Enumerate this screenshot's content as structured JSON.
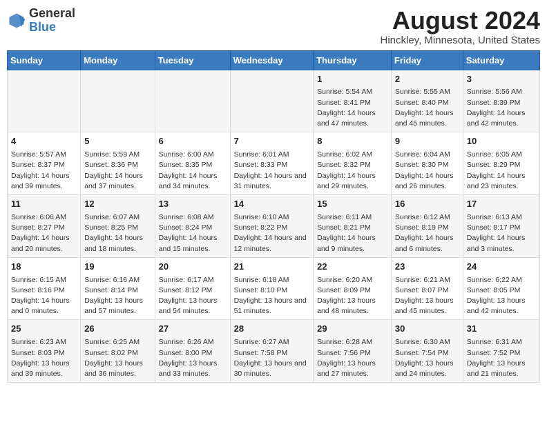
{
  "header": {
    "logo_general": "General",
    "logo_blue": "Blue",
    "month_year": "August 2024",
    "location": "Hinckley, Minnesota, United States"
  },
  "days_of_week": [
    "Sunday",
    "Monday",
    "Tuesday",
    "Wednesday",
    "Thursday",
    "Friday",
    "Saturday"
  ],
  "weeks": [
    [
      {
        "day": "",
        "sunrise": "",
        "sunset": "",
        "daylight": ""
      },
      {
        "day": "",
        "sunrise": "",
        "sunset": "",
        "daylight": ""
      },
      {
        "day": "",
        "sunrise": "",
        "sunset": "",
        "daylight": ""
      },
      {
        "day": "",
        "sunrise": "",
        "sunset": "",
        "daylight": ""
      },
      {
        "day": "1",
        "sunrise": "Sunrise: 5:54 AM",
        "sunset": "Sunset: 8:41 PM",
        "daylight": "Daylight: 14 hours and 47 minutes."
      },
      {
        "day": "2",
        "sunrise": "Sunrise: 5:55 AM",
        "sunset": "Sunset: 8:40 PM",
        "daylight": "Daylight: 14 hours and 45 minutes."
      },
      {
        "day": "3",
        "sunrise": "Sunrise: 5:56 AM",
        "sunset": "Sunset: 8:39 PM",
        "daylight": "Daylight: 14 hours and 42 minutes."
      }
    ],
    [
      {
        "day": "4",
        "sunrise": "Sunrise: 5:57 AM",
        "sunset": "Sunset: 8:37 PM",
        "daylight": "Daylight: 14 hours and 39 minutes."
      },
      {
        "day": "5",
        "sunrise": "Sunrise: 5:59 AM",
        "sunset": "Sunset: 8:36 PM",
        "daylight": "Daylight: 14 hours and 37 minutes."
      },
      {
        "day": "6",
        "sunrise": "Sunrise: 6:00 AM",
        "sunset": "Sunset: 8:35 PM",
        "daylight": "Daylight: 14 hours and 34 minutes."
      },
      {
        "day": "7",
        "sunrise": "Sunrise: 6:01 AM",
        "sunset": "Sunset: 8:33 PM",
        "daylight": "Daylight: 14 hours and 31 minutes."
      },
      {
        "day": "8",
        "sunrise": "Sunrise: 6:02 AM",
        "sunset": "Sunset: 8:32 PM",
        "daylight": "Daylight: 14 hours and 29 minutes."
      },
      {
        "day": "9",
        "sunrise": "Sunrise: 6:04 AM",
        "sunset": "Sunset: 8:30 PM",
        "daylight": "Daylight: 14 hours and 26 minutes."
      },
      {
        "day": "10",
        "sunrise": "Sunrise: 6:05 AM",
        "sunset": "Sunset: 8:29 PM",
        "daylight": "Daylight: 14 hours and 23 minutes."
      }
    ],
    [
      {
        "day": "11",
        "sunrise": "Sunrise: 6:06 AM",
        "sunset": "Sunset: 8:27 PM",
        "daylight": "Daylight: 14 hours and 20 minutes."
      },
      {
        "day": "12",
        "sunrise": "Sunrise: 6:07 AM",
        "sunset": "Sunset: 8:25 PM",
        "daylight": "Daylight: 14 hours and 18 minutes."
      },
      {
        "day": "13",
        "sunrise": "Sunrise: 6:08 AM",
        "sunset": "Sunset: 8:24 PM",
        "daylight": "Daylight: 14 hours and 15 minutes."
      },
      {
        "day": "14",
        "sunrise": "Sunrise: 6:10 AM",
        "sunset": "Sunset: 8:22 PM",
        "daylight": "Daylight: 14 hours and 12 minutes."
      },
      {
        "day": "15",
        "sunrise": "Sunrise: 6:11 AM",
        "sunset": "Sunset: 8:21 PM",
        "daylight": "Daylight: 14 hours and 9 minutes."
      },
      {
        "day": "16",
        "sunrise": "Sunrise: 6:12 AM",
        "sunset": "Sunset: 8:19 PM",
        "daylight": "Daylight: 14 hours and 6 minutes."
      },
      {
        "day": "17",
        "sunrise": "Sunrise: 6:13 AM",
        "sunset": "Sunset: 8:17 PM",
        "daylight": "Daylight: 14 hours and 3 minutes."
      }
    ],
    [
      {
        "day": "18",
        "sunrise": "Sunrise: 6:15 AM",
        "sunset": "Sunset: 8:16 PM",
        "daylight": "Daylight: 14 hours and 0 minutes."
      },
      {
        "day": "19",
        "sunrise": "Sunrise: 6:16 AM",
        "sunset": "Sunset: 8:14 PM",
        "daylight": "Daylight: 13 hours and 57 minutes."
      },
      {
        "day": "20",
        "sunrise": "Sunrise: 6:17 AM",
        "sunset": "Sunset: 8:12 PM",
        "daylight": "Daylight: 13 hours and 54 minutes."
      },
      {
        "day": "21",
        "sunrise": "Sunrise: 6:18 AM",
        "sunset": "Sunset: 8:10 PM",
        "daylight": "Daylight: 13 hours and 51 minutes."
      },
      {
        "day": "22",
        "sunrise": "Sunrise: 6:20 AM",
        "sunset": "Sunset: 8:09 PM",
        "daylight": "Daylight: 13 hours and 48 minutes."
      },
      {
        "day": "23",
        "sunrise": "Sunrise: 6:21 AM",
        "sunset": "Sunset: 8:07 PM",
        "daylight": "Daylight: 13 hours and 45 minutes."
      },
      {
        "day": "24",
        "sunrise": "Sunrise: 6:22 AM",
        "sunset": "Sunset: 8:05 PM",
        "daylight": "Daylight: 13 hours and 42 minutes."
      }
    ],
    [
      {
        "day": "25",
        "sunrise": "Sunrise: 6:23 AM",
        "sunset": "Sunset: 8:03 PM",
        "daylight": "Daylight: 13 hours and 39 minutes."
      },
      {
        "day": "26",
        "sunrise": "Sunrise: 6:25 AM",
        "sunset": "Sunset: 8:02 PM",
        "daylight": "Daylight: 13 hours and 36 minutes."
      },
      {
        "day": "27",
        "sunrise": "Sunrise: 6:26 AM",
        "sunset": "Sunset: 8:00 PM",
        "daylight": "Daylight: 13 hours and 33 minutes."
      },
      {
        "day": "28",
        "sunrise": "Sunrise: 6:27 AM",
        "sunset": "Sunset: 7:58 PM",
        "daylight": "Daylight: 13 hours and 30 minutes."
      },
      {
        "day": "29",
        "sunrise": "Sunrise: 6:28 AM",
        "sunset": "Sunset: 7:56 PM",
        "daylight": "Daylight: 13 hours and 27 minutes."
      },
      {
        "day": "30",
        "sunrise": "Sunrise: 6:30 AM",
        "sunset": "Sunset: 7:54 PM",
        "daylight": "Daylight: 13 hours and 24 minutes."
      },
      {
        "day": "31",
        "sunrise": "Sunrise: 6:31 AM",
        "sunset": "Sunset: 7:52 PM",
        "daylight": "Daylight: 13 hours and 21 minutes."
      }
    ]
  ],
  "colors": {
    "header_bg": "#3a7abf",
    "odd_row": "#f5f5f5",
    "even_row": "#ffffff"
  }
}
